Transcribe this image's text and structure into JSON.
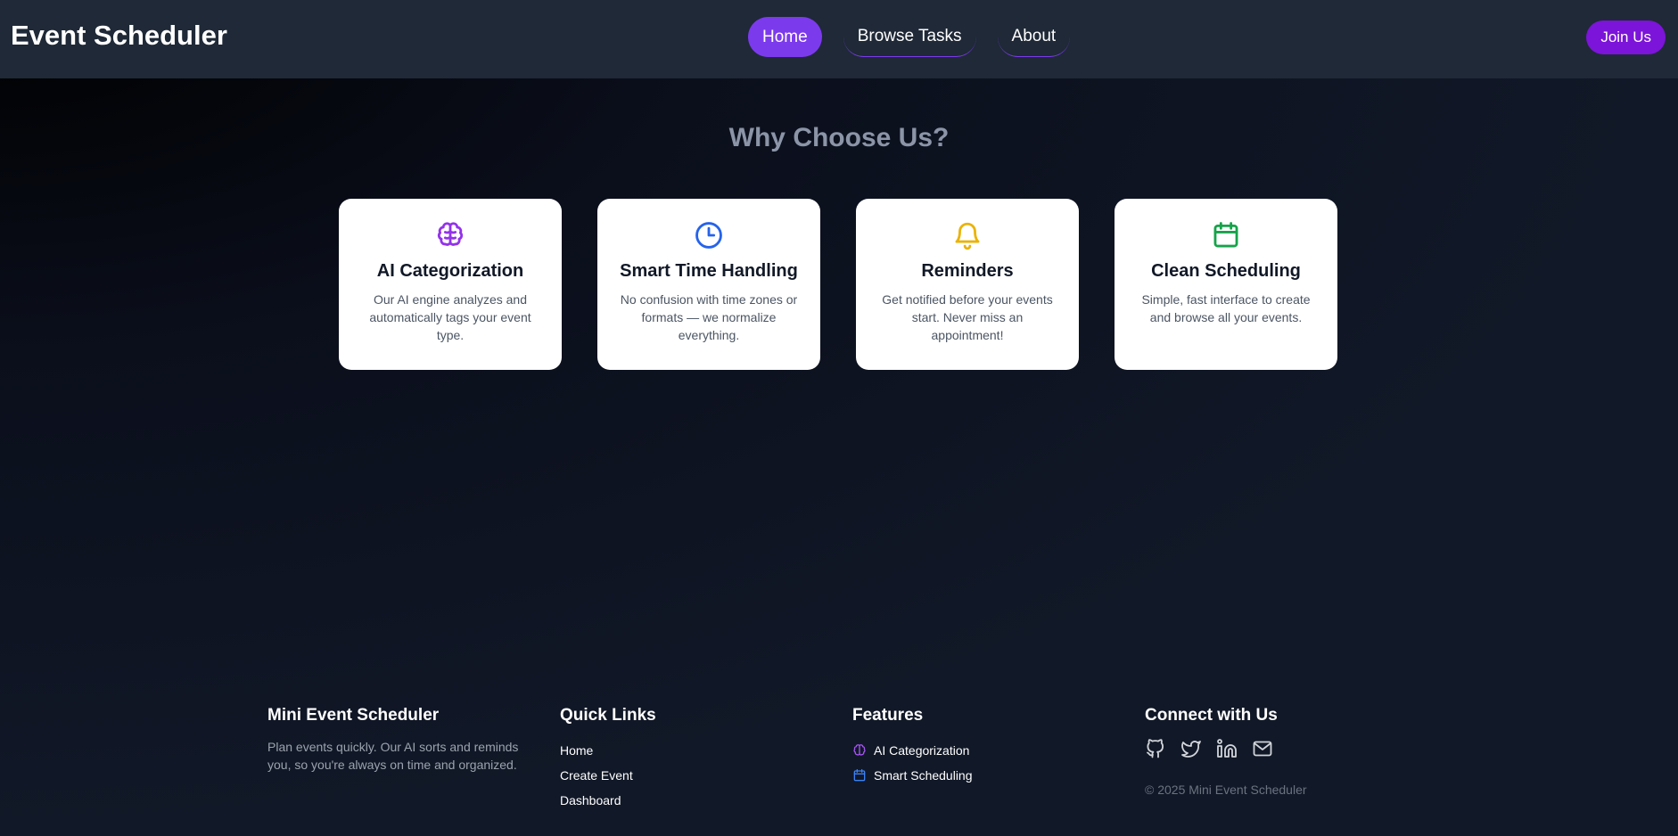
{
  "header": {
    "brand": "Event Scheduler",
    "nav": [
      {
        "label": "Home",
        "active": true
      },
      {
        "label": "Browse Tasks",
        "active": false
      },
      {
        "label": "About",
        "active": false
      }
    ],
    "cta": "Join Us"
  },
  "why": {
    "title": "Why Choose Us?",
    "cards": [
      {
        "icon": "brain-icon",
        "title": "AI Categorization",
        "desc": "Our AI engine analyzes and automatically tags your event type.",
        "color": "#9333ea"
      },
      {
        "icon": "clock-icon",
        "title": "Smart Time Handling",
        "desc": "No confusion with time zones or formats — we normalize everything.",
        "color": "#2563eb"
      },
      {
        "icon": "bell-icon",
        "title": "Reminders",
        "desc": "Get notified before your events start. Never miss an appointment!",
        "color": "#eab308"
      },
      {
        "icon": "calendar-icon",
        "title": "Clean Scheduling",
        "desc": "Simple, fast interface to create and browse all your events.",
        "color": "#16a34a"
      }
    ]
  },
  "footer": {
    "about": {
      "title": "Mini Event Scheduler",
      "desc": "Plan events quickly. Our AI sorts and reminds you, so you're always on time and organized."
    },
    "quick_links": {
      "title": "Quick Links",
      "items": [
        "Home",
        "Create Event",
        "Dashboard"
      ]
    },
    "features": {
      "title": "Features",
      "items": [
        {
          "label": "AI Categorization",
          "icon": "brain-icon"
        },
        {
          "label": "Smart Scheduling",
          "icon": "calendar-icon"
        }
      ]
    },
    "connect": {
      "title": "Connect with Us",
      "icons": [
        "github-icon",
        "twitter-icon",
        "linkedin-icon",
        "mail-icon"
      ],
      "copyright": "© 2025 Mini Event Scheduler"
    }
  },
  "colors": {
    "accent": "#7c3aed",
    "header_bg": "#1f2937",
    "cta_bg": "#7c14d9"
  }
}
